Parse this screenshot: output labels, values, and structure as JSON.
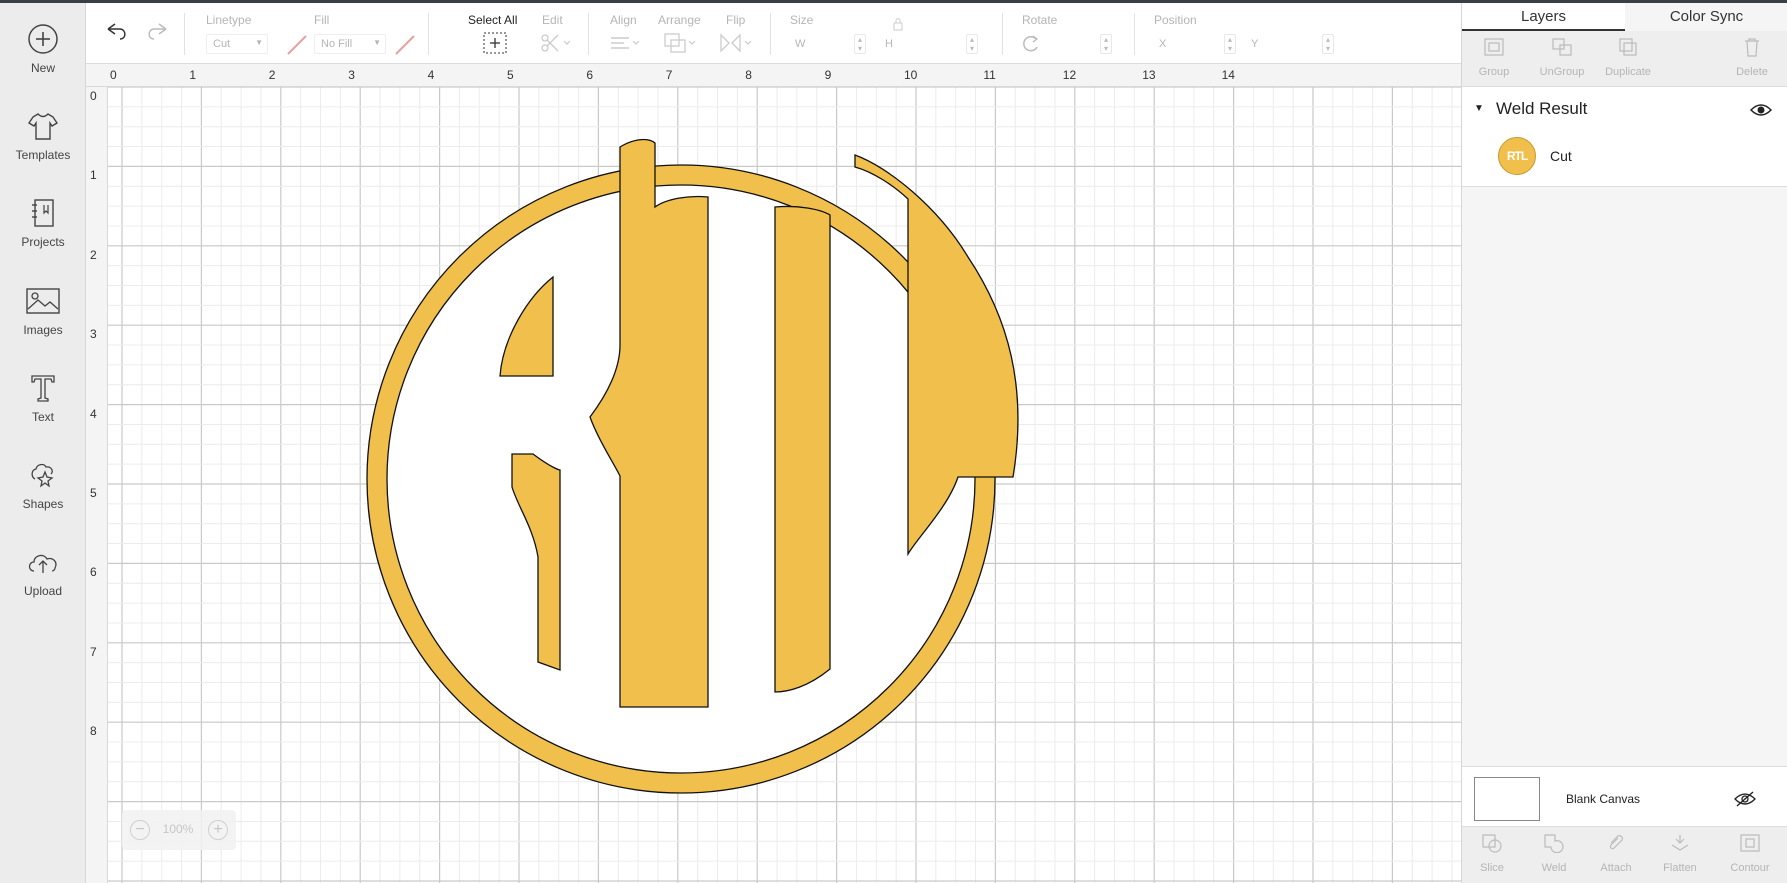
{
  "sidebar": {
    "items": [
      {
        "label": "New",
        "icon": "plus-circle-icon"
      },
      {
        "label": "Templates",
        "icon": "tshirt-icon"
      },
      {
        "label": "Projects",
        "icon": "notebook-icon"
      },
      {
        "label": "Images",
        "icon": "image-icon"
      },
      {
        "label": "Text",
        "icon": "text-icon"
      },
      {
        "label": "Shapes",
        "icon": "shapes-icon"
      },
      {
        "label": "Upload",
        "icon": "cloud-upload-icon"
      }
    ]
  },
  "toolbar": {
    "linetype_label": "Linetype",
    "linetype_value": "Cut",
    "fill_label": "Fill",
    "fill_value": "No Fill",
    "select_all_label": "Select All",
    "edit_label": "Edit",
    "align_label": "Align",
    "arrange_label": "Arrange",
    "flip_label": "Flip",
    "size_label": "Size",
    "size_w": "W",
    "size_h": "H",
    "rotate_label": "Rotate",
    "position_label": "Position",
    "position_x": "X",
    "position_y": "Y"
  },
  "canvas": {
    "ruler_x": [
      "0",
      "1",
      "2",
      "3",
      "4",
      "5",
      "6",
      "7",
      "8",
      "9",
      "10",
      "11",
      "12",
      "13",
      "14"
    ],
    "ruler_y": [
      "0",
      "1",
      "2",
      "3",
      "4",
      "5",
      "6",
      "7",
      "8"
    ],
    "zoom_value": "100%",
    "design_color": "#f0bf4c",
    "monogram": "RTL"
  },
  "right_panel": {
    "tabs": [
      "Layers",
      "Color Sync"
    ],
    "layer_tools": [
      "Group",
      "UnGroup",
      "Duplicate",
      "Delete"
    ],
    "group_title": "Weld Result",
    "layer_name": "Cut",
    "layer_thumb_text": "RTL",
    "blank_canvas_label": "Blank Canvas",
    "bottom_tools": [
      "Slice",
      "Weld",
      "Attach",
      "Flatten",
      "Contour"
    ]
  }
}
